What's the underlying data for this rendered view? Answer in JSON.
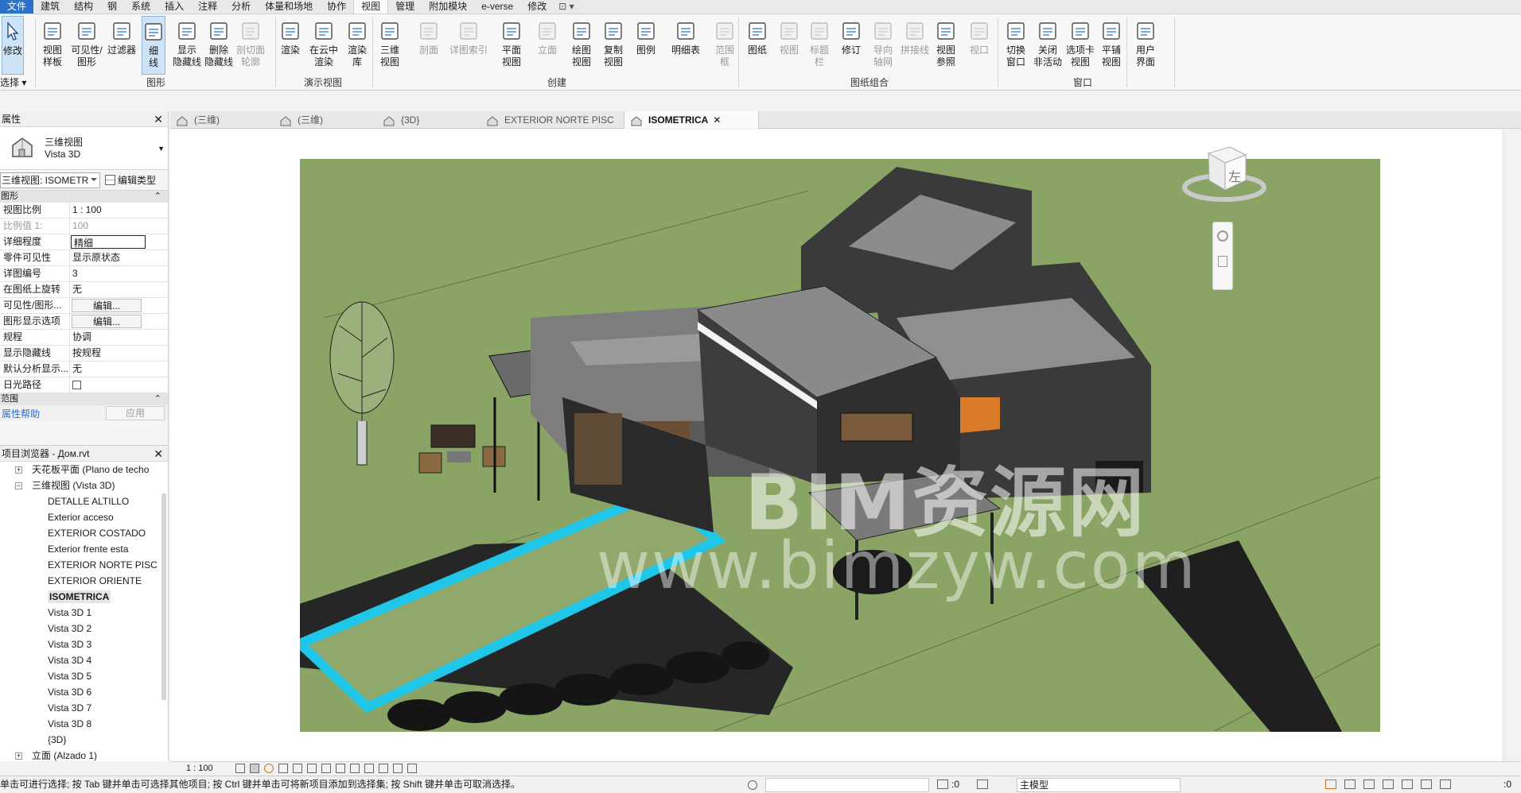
{
  "menu": {
    "tabs": [
      "文件",
      "建筑",
      "结构",
      "钢",
      "系统",
      "插入",
      "注释",
      "分析",
      "体量和场地",
      "协作",
      "视图",
      "管理",
      "附加模块",
      "e-verse",
      "修改"
    ],
    "active": "视图",
    "extra": "⊡ ▾"
  },
  "ribbon": {
    "select_label": "修改",
    "select_dropdown": "选择 ▾",
    "buttons": [
      {
        "id": "view-template",
        "l1": "视图",
        "l2": "样板",
        "icon": "template-icon"
      },
      {
        "id": "vis-graphics",
        "l1": "可见性/",
        "l2": "图形",
        "icon": "visibility-icon"
      },
      {
        "id": "filters",
        "l1": "过滤器",
        "l2": "",
        "icon": "filter-icon"
      },
      {
        "id": "thin-lines",
        "l1": "细",
        "l2": "线",
        "icon": "thin-lines-icon"
      },
      {
        "id": "show-hidden",
        "l1": "显示",
        "l2": "隐藏线",
        "icon": "show-hidden-icon"
      },
      {
        "id": "remove-hidden",
        "l1": "删除",
        "l2": "隐藏线",
        "icon": "remove-hidden-icon"
      },
      {
        "id": "cut-profile",
        "l1": "剖切面",
        "l2": "轮廓",
        "icon": "cut-profile-icon"
      },
      {
        "id": "render",
        "l1": "渲染",
        "l2": "",
        "icon": "teapot-icon"
      },
      {
        "id": "render-cloud",
        "l1": "在云中",
        "l2": "渲染",
        "icon": "cloud-render-icon"
      },
      {
        "id": "render-gallery",
        "l1": "渲染",
        "l2": "库",
        "icon": "gallery-icon"
      },
      {
        "id": "3d-view",
        "l1": "三维",
        "l2": "视图",
        "icon": "house-3d-icon"
      },
      {
        "id": "section",
        "l1": "剖面",
        "l2": "",
        "icon": "section-icon"
      },
      {
        "id": "callout",
        "l1": "详图索引",
        "l2": "",
        "icon": "callout-icon"
      },
      {
        "id": "plan-views",
        "l1": "平面",
        "l2": "视图",
        "icon": "plan-icon"
      },
      {
        "id": "elevation",
        "l1": "立面",
        "l2": "",
        "icon": "elevation-icon"
      },
      {
        "id": "drafting-view",
        "l1": "绘图",
        "l2": "视图",
        "icon": "drafting-icon"
      },
      {
        "id": "duplicate-view",
        "l1": "复制",
        "l2": "视图",
        "icon": "duplicate-icon"
      },
      {
        "id": "legends",
        "l1": "图例",
        "l2": "",
        "icon": "legend-icon"
      },
      {
        "id": "schedules",
        "l1": "明细表",
        "l2": "",
        "icon": "schedule-icon"
      },
      {
        "id": "scope-box",
        "l1": "范围",
        "l2": "框",
        "icon": "scope-box-icon"
      },
      {
        "id": "sheet",
        "l1": "图纸",
        "l2": "",
        "icon": "sheet-icon"
      },
      {
        "id": "place-view",
        "l1": "视图",
        "l2": "",
        "icon": "place-view-icon"
      },
      {
        "id": "title-block",
        "l1": "标题",
        "l2": "栏",
        "icon": "title-block-icon"
      },
      {
        "id": "revisions",
        "l1": "修订",
        "l2": "",
        "icon": "revision-icon"
      },
      {
        "id": "guide-grid",
        "l1": "导向",
        "l2": "轴网",
        "icon": "guide-grid-icon"
      },
      {
        "id": "matchline",
        "l1": "拼接线",
        "l2": "",
        "icon": "matchline-icon"
      },
      {
        "id": "view-reference",
        "l1": "视图",
        "l2": "参照",
        "icon": "view-ref-icon"
      },
      {
        "id": "viewports",
        "l1": "视口",
        "l2": "",
        "icon": "viewport-icon"
      },
      {
        "id": "switch-windows",
        "l1": "切换",
        "l2": "窗口",
        "icon": "switch-windows-icon"
      },
      {
        "id": "close-inactive",
        "l1": "关闭",
        "l2": "非活动",
        "icon": "close-inactive-icon"
      },
      {
        "id": "tab-views",
        "l1": "选项卡",
        "l2": "视图",
        "icon": "tab-views-icon"
      },
      {
        "id": "tile-views",
        "l1": "平铺",
        "l2": "视图",
        "icon": "tile-views-icon"
      },
      {
        "id": "user-interface",
        "l1": "用户",
        "l2": "界面",
        "icon": "ui-icon"
      }
    ],
    "panels": [
      "图形",
      "演示视图",
      "创建",
      "图纸组合",
      "窗口"
    ]
  },
  "properties": {
    "title": "属性",
    "type_line1": "三维视图",
    "type_line2": "Vista 3D",
    "view_selector": "三维视图: ISOMETR",
    "edit_type": "编辑类型",
    "group_graphics": "图形",
    "rows": [
      {
        "k": "视图比例",
        "v": "1 : 100"
      },
      {
        "k": "比例值 1:",
        "v": "100"
      },
      {
        "k": "详细程度",
        "v": "精细"
      },
      {
        "k": "零件可见性",
        "v": "显示原状态"
      },
      {
        "k": "详图编号",
        "v": "3"
      },
      {
        "k": "在图纸上旋转",
        "v": "无"
      },
      {
        "k": "可见性/图形...",
        "v": "编辑..."
      },
      {
        "k": "图形显示选项",
        "v": "编辑..."
      },
      {
        "k": "规程",
        "v": "协调"
      },
      {
        "k": "显示隐藏线",
        "v": "按规程"
      },
      {
        "k": "默认分析显示...",
        "v": "无"
      },
      {
        "k": "日光路径",
        "v": ""
      }
    ],
    "group_extents": "范围",
    "help": "属性帮助",
    "apply": "应用"
  },
  "browser": {
    "title": "项目浏览器 - Дом.rvt",
    "nodes": [
      {
        "level": 1,
        "toggle": "+",
        "label": "天花板平面 (Plano de techo"
      },
      {
        "level": 1,
        "toggle": "−",
        "label": "三维视图 (Vista 3D)"
      },
      {
        "level": 2,
        "label": "DETALLE ALTILLO"
      },
      {
        "level": 2,
        "label": "Exterior acceso"
      },
      {
        "level": 2,
        "label": "EXTERIOR COSTADO"
      },
      {
        "level": 2,
        "label": "Exterior frente esta"
      },
      {
        "level": 2,
        "label": "EXTERIOR NORTE PISC"
      },
      {
        "level": 2,
        "label": "EXTERIOR ORIENTE"
      },
      {
        "level": 2,
        "label": "ISOMETRICA",
        "active": true
      },
      {
        "level": 2,
        "label": "Vista 3D 1"
      },
      {
        "level": 2,
        "label": "Vista 3D 2"
      },
      {
        "level": 2,
        "label": "Vista 3D 3"
      },
      {
        "level": 2,
        "label": "Vista 3D 4"
      },
      {
        "level": 2,
        "label": "Vista 3D 5"
      },
      {
        "level": 2,
        "label": "Vista 3D 6"
      },
      {
        "level": 2,
        "label": "Vista 3D 7"
      },
      {
        "level": 2,
        "label": "Vista 3D 8"
      },
      {
        "level": 2,
        "label": "{3D}"
      },
      {
        "level": 1,
        "toggle": "+",
        "label": "立面 (Alzado 1)"
      }
    ]
  },
  "view_tabs": [
    {
      "label": "(三维)",
      "active": false
    },
    {
      "label": "(三维)",
      "active": false
    },
    {
      "label": "{3D}",
      "active": false
    },
    {
      "label": "EXTERIOR NORTE PISC",
      "active": false
    },
    {
      "label": "ISOMETRICA",
      "active": true,
      "close": "✕"
    }
  ],
  "viewcube": {
    "face": "左"
  },
  "watermark": {
    "line1": "BIM资源网",
    "line2": "www.bimzyw.com"
  },
  "view_bar": {
    "scale": "1 : 100"
  },
  "status": {
    "message": "单击可进行选择; 按 Tab 键并单击可选择其他项目; 按 Ctrl 键并单击可将新项目添加到选择集; 按 Shift 键并单击可取消选择。",
    "zero1": ":0",
    "model": "主模型",
    "zero2": ":0"
  },
  "colors": {
    "accent": "#2a72c9",
    "grass": "#8aa465",
    "pool": "#20c6e8",
    "building": "#3a3a3a"
  }
}
